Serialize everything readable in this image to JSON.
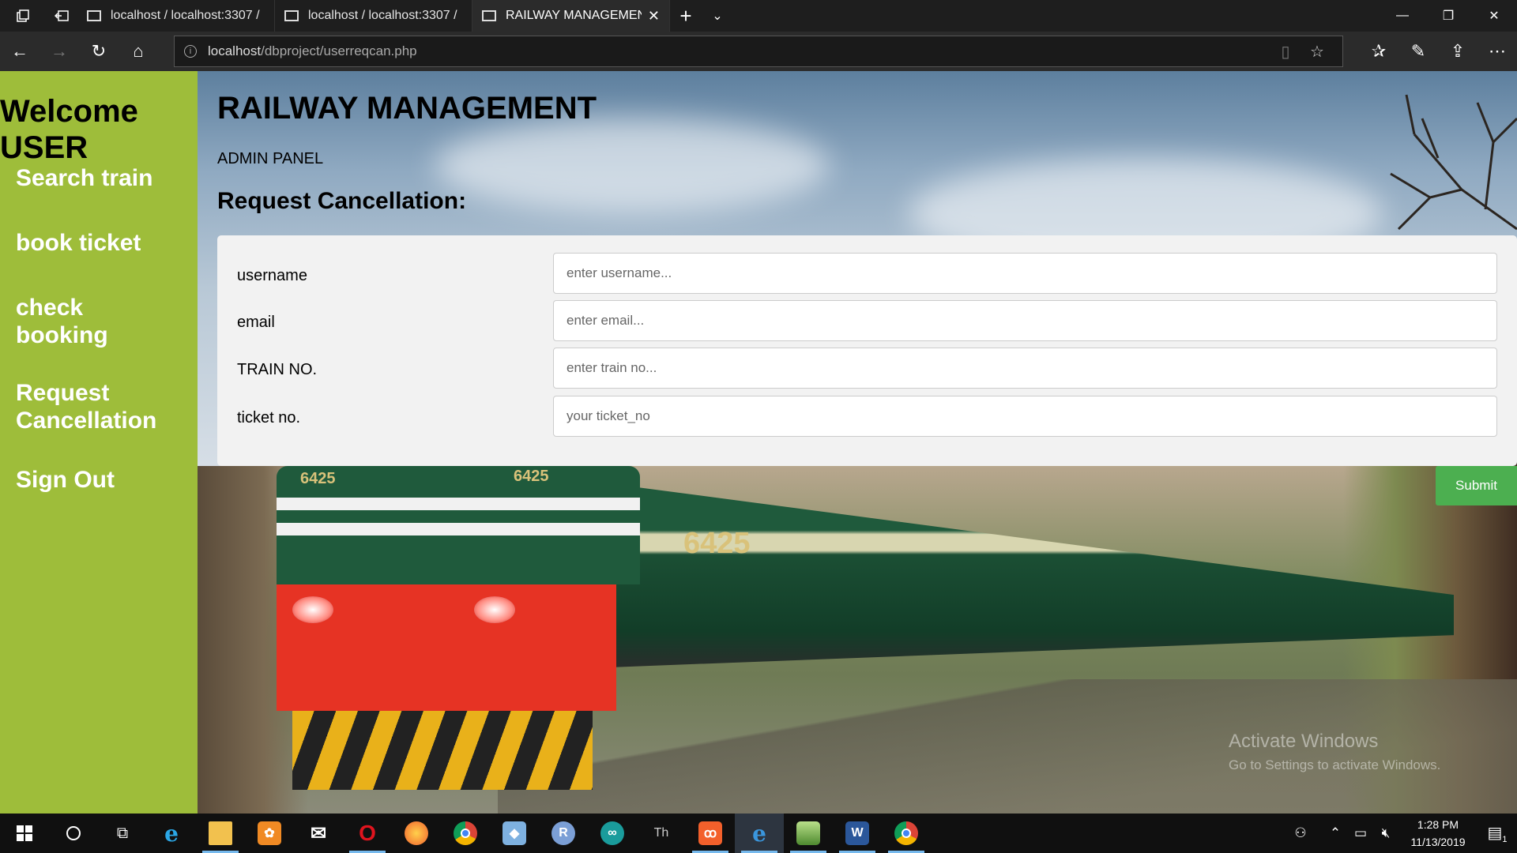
{
  "browser": {
    "tabs": [
      {
        "label": "localhost / localhost:3307 /",
        "active": false
      },
      {
        "label": "localhost / localhost:3307 /",
        "active": false
      },
      {
        "label": "RAILWAY MANAGEMEN",
        "active": true
      }
    ],
    "url_host": "localhost",
    "url_path": "/dbproject/userreqcan.php"
  },
  "sidebar": {
    "welcome_line1": "Welcome",
    "welcome_line2": "USER",
    "items": [
      {
        "label": "Search train"
      },
      {
        "label": "book ticket"
      },
      {
        "label": "check booking"
      },
      {
        "label": "Request Cancellation"
      },
      {
        "label": "Sign Out"
      }
    ]
  },
  "header": {
    "title": "RAILWAY MANAGEMENT",
    "subtitle": "ADMIN PANEL",
    "section": "Request Cancellation:"
  },
  "form": {
    "fields": [
      {
        "label": "username",
        "placeholder": "enter username...",
        "value": ""
      },
      {
        "label": "email",
        "placeholder": "enter email...",
        "value": ""
      },
      {
        "label": "TRAIN NO.",
        "placeholder": "enter train no...",
        "value": ""
      },
      {
        "label": "ticket no.",
        "placeholder": "your ticket_no",
        "value": ""
      }
    ],
    "submit_label": "Submit"
  },
  "background_image": {
    "loco_number": "6425",
    "front_number": "6425"
  },
  "watermark": {
    "line1": "Activate Windows",
    "line2": "Go to Settings to activate Windows."
  },
  "taskbar": {
    "time": "1:28 PM",
    "date": "11/13/2019",
    "notification_count": "1"
  },
  "colors": {
    "sidebar": "#9ebd3a",
    "submit": "#4caf50",
    "panel": "#f2f2f2"
  }
}
